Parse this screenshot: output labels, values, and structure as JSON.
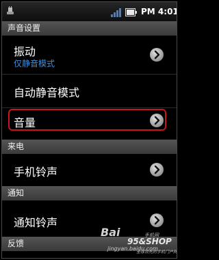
{
  "status_bar": {
    "time": "PM 4:01",
    "icons": [
      "usb-icon",
      "signal-icon",
      "battery-icon"
    ]
  },
  "sections": [
    {
      "header": "声音设置"
    },
    {
      "header": "来电"
    },
    {
      "header": "通知"
    },
    {
      "header": "反馈"
    }
  ],
  "items": {
    "vibrate": {
      "label": "振动",
      "value": "仅静音模式"
    },
    "auto_silent": {
      "label": "自动静音模式"
    },
    "volume": {
      "label": "音量"
    },
    "ringtone": {
      "label": "手机铃声"
    },
    "notification_tone": {
      "label": "通知铃声"
    }
  },
  "watermark": {
    "baidu_logo": "Bai",
    "baidu_experience": "jingyan.baidu.com",
    "site": "95&SHOP",
    "site_sub": "全球领先的手机门户网络",
    "small_text": "手机网"
  },
  "colors": {
    "section_bg": "#4a4a4a",
    "subtitle": "#3d8fe0",
    "highlight": "#c8161d"
  }
}
